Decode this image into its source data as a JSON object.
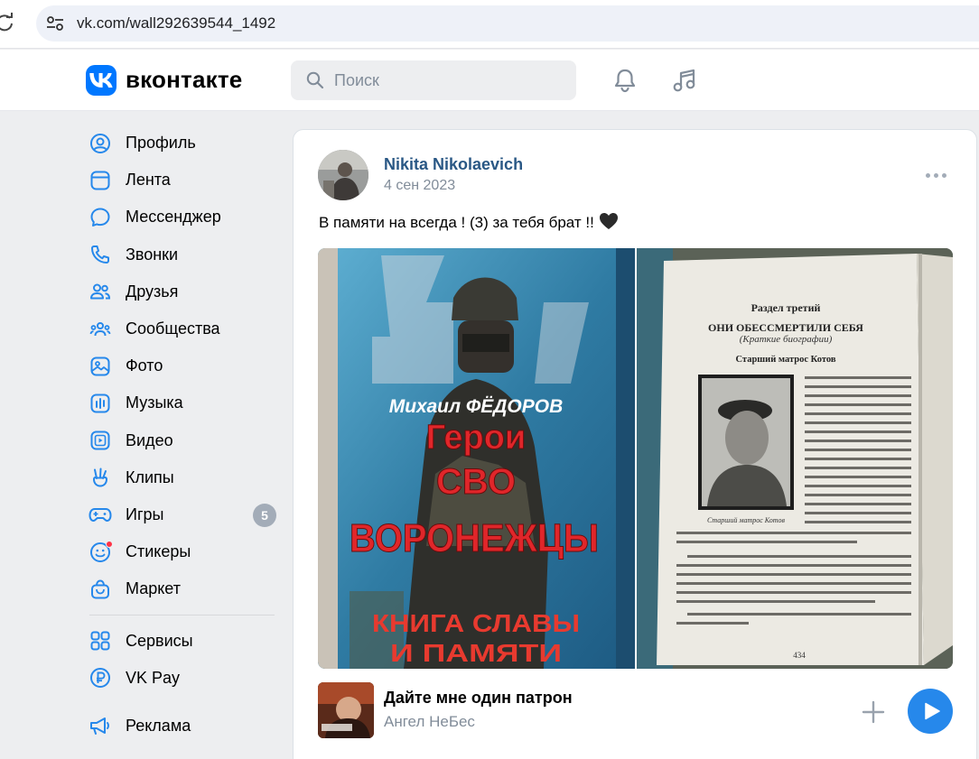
{
  "browser": {
    "url": "vk.com/wall292639544_1492"
  },
  "header": {
    "brand": "вконтакте",
    "search_placeholder": "Поиск"
  },
  "sidebar": {
    "items": [
      {
        "label": "Профиль",
        "icon": "profile-icon"
      },
      {
        "label": "Лента",
        "icon": "feed-icon"
      },
      {
        "label": "Мессенджер",
        "icon": "messenger-icon"
      },
      {
        "label": "Звонки",
        "icon": "calls-icon"
      },
      {
        "label": "Друзья",
        "icon": "friends-icon"
      },
      {
        "label": "Сообщества",
        "icon": "communities-icon"
      },
      {
        "label": "Фото",
        "icon": "photos-icon"
      },
      {
        "label": "Музыка",
        "icon": "music-icon"
      },
      {
        "label": "Видео",
        "icon": "video-icon"
      },
      {
        "label": "Клипы",
        "icon": "clips-icon"
      },
      {
        "label": "Игры",
        "icon": "games-icon",
        "counter": "5"
      },
      {
        "label": "Стикеры",
        "icon": "stickers-icon"
      },
      {
        "label": "Маркет",
        "icon": "market-icon"
      }
    ],
    "secondary": [
      {
        "label": "Сервисы",
        "icon": "services-icon"
      },
      {
        "label": "VK Pay",
        "icon": "vkpay-icon"
      },
      {
        "label": "Реклама",
        "icon": "ads-icon"
      }
    ]
  },
  "post": {
    "author": "Nikita Nikolaevich",
    "date": "4 сен 2023",
    "text": "В памяти на всегда ! (3) за тебя брат !!",
    "photo1": {
      "cover_author": "Михаил ФЁДОРОВ",
      "cover_title_1": "Герои",
      "cover_title_2": "СВО",
      "cover_title_3": "ВОРОНЕЖЦЫ",
      "cover_subtitle_1": "КНИГА СЛАВЫ",
      "cover_subtitle_2": "И ПАМЯТИ"
    },
    "photo2": {
      "section": "Раздел третий",
      "heading": "ОНИ ОБЕССМЕРТИЛИ СЕБЯ",
      "subheading": "(Краткие биографии)",
      "rank_name": "Старший матрос Котов",
      "caption": "Старший матрос Котов",
      "page_number": "434"
    },
    "audio": {
      "title": "Дайте мне один патрон",
      "artist": "Ангел НеБес"
    }
  },
  "colors": {
    "accent": "#0077ff",
    "link": "#2a5885",
    "secondary_text": "#818c99",
    "play_button": "#2688eb",
    "background": "#edeef0"
  }
}
